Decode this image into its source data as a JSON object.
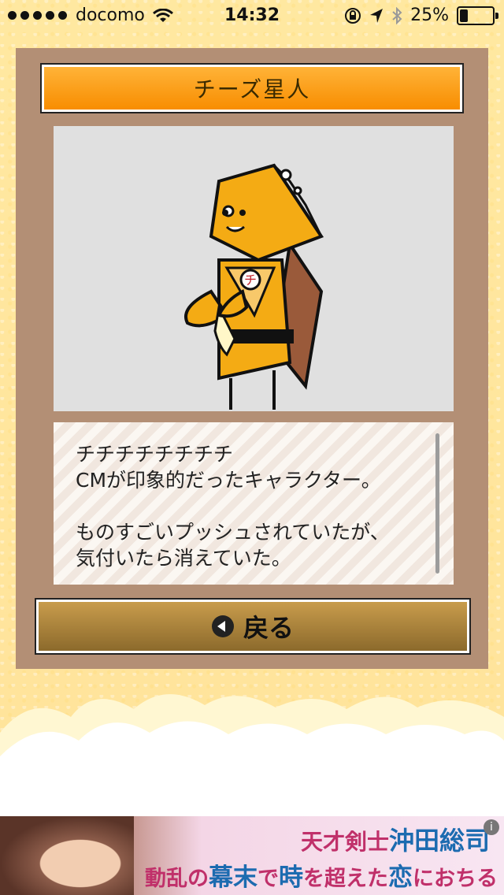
{
  "status_bar": {
    "carrier": "docomo",
    "time": "14:32",
    "battery": "25%",
    "battery_level": 0.25
  },
  "card": {
    "title": "チーズ星人",
    "description_lines": [
      "チチチチチチチチ",
      "CMが印象的だったキャラクター。",
      "",
      "ものすごいプッシュされていたが、",
      "気付いたら消えていた。"
    ],
    "character_badge": "チ",
    "back_label": "戻る"
  },
  "ad": {
    "line1_prefix": "天才剣士",
    "line1_name": "沖田総司",
    "line2_a": "動乱の",
    "line2_b": "幕末",
    "line2_c": "で",
    "line2_d": "時",
    "line2_e": "を超えた",
    "line2_f": "恋",
    "line2_g": "におちる",
    "info_icon": "i"
  },
  "colors": {
    "background": "#ffe9a6",
    "panel": "#b38f75",
    "title_plate": "#f88d00",
    "back_button": "#a07a38"
  }
}
